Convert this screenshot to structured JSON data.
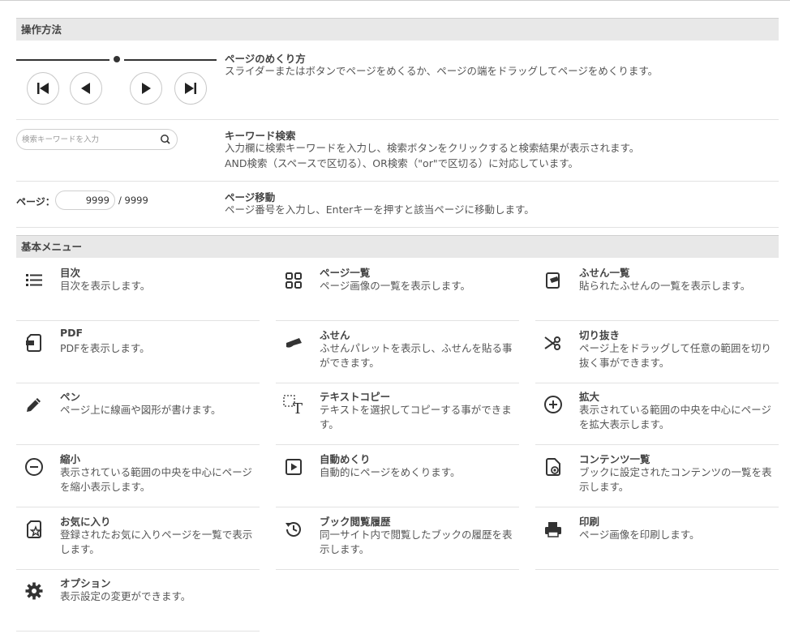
{
  "operation": {
    "header": "操作方法",
    "page_turn": {
      "title": "ページのめくり方",
      "desc": "スライダーまたはボタンでページをめくるか、ページの端をドラッグしてページをめくります。"
    },
    "keyword_search": {
      "placeholder": "検索キーワードを入力",
      "title": "キーワード検索",
      "desc1": "入力欄に検索キーワードを入力し、検索ボタンをクリックすると検索結果が表示されます。",
      "desc2": "AND検索（スペースで区切る）、OR検索（\"or\"で区切る）に対応しています。"
    },
    "page_move": {
      "label": "ページ：",
      "current": "9999",
      "total": "/ 9999",
      "title": "ページ移動",
      "desc": "ページ番号を入力し、Enterキーを押すと該当ページに移動します。"
    },
    "nav_buttons": [
      "first-page-icon",
      "previous-page-icon",
      "next-page-icon",
      "last-page-icon"
    ]
  },
  "menu": {
    "header": "基本メニュー",
    "items": [
      {
        "icon": "list-icon",
        "title": "目次",
        "desc": "目次を表示します。"
      },
      {
        "icon": "grid-icon",
        "title": "ページ一覧",
        "desc": "ページ画像の一覧を表示します。"
      },
      {
        "icon": "sticky-list-icon",
        "title": "ふせん一覧",
        "desc": "貼られたふせんの一覧を表示します。"
      },
      {
        "icon": "pdf-icon",
        "title": "PDF",
        "desc": "PDFを表示します。"
      },
      {
        "icon": "sticky-note-icon",
        "title": "ふせん",
        "desc": "ふせんパレットを表示し、ふせんを貼る事ができます。"
      },
      {
        "icon": "scissors-icon",
        "title": "切り抜き",
        "desc": "ページ上をドラッグして任意の範囲を切り抜く事ができます。"
      },
      {
        "icon": "pen-icon",
        "title": "ペン",
        "desc": "ページ上に線画や図形が書けます。"
      },
      {
        "icon": "text-copy-icon",
        "title": "テキストコピー",
        "desc": "テキストを選択してコピーする事ができます。"
      },
      {
        "icon": "zoom-in-icon",
        "title": "拡大",
        "desc": "表示されている範囲の中央を中心にページを拡大表示します。"
      },
      {
        "icon": "zoom-out-icon",
        "title": "縮小",
        "desc": "表示されている範囲の中央を中心にページを縮小表示します。"
      },
      {
        "icon": "autoplay-icon",
        "title": "自動めくり",
        "desc": "自動的にページをめくります。"
      },
      {
        "icon": "contents-list-icon",
        "title": "コンテンツ一覧",
        "desc": "ブックに設定されたコンテンツの一覧を表示します。"
      },
      {
        "icon": "favorite-icon",
        "title": "お気に入り",
        "desc": "登録されたお気に入りページを一覧で表示します。"
      },
      {
        "icon": "history-icon",
        "title": "ブック閲覧履歴",
        "desc": "同一サイト内で閲覧したブックの履歴を表示します。"
      },
      {
        "icon": "print-icon",
        "title": "印刷",
        "desc": "ページ画像を印刷します。"
      },
      {
        "icon": "gear-icon",
        "title": "オプション",
        "desc": "表示設定の変更ができます。"
      }
    ]
  }
}
